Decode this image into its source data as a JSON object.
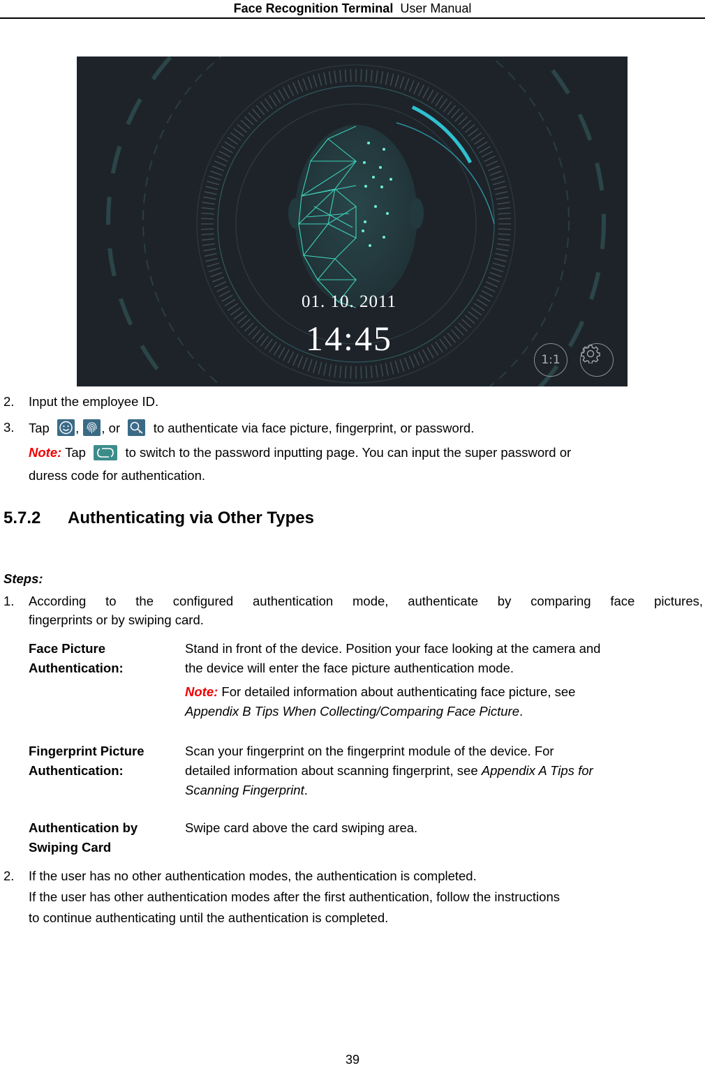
{
  "header": {
    "product": "Face Recognition Terminal",
    "doc_type": "User Manual"
  },
  "screenshot": {
    "date": "01. 10. 2011",
    "time": "14:45",
    "ratio_button": "1:1",
    "settings_icon": "gear-icon",
    "progress_fraction": 0.1,
    "colors": {
      "background": "#1e232a",
      "accent": "#2fc1d0",
      "mesh": "#3fd0bb"
    }
  },
  "steps_before": [
    {
      "number": "2.",
      "text": "Input the employee ID."
    },
    {
      "number": "3.",
      "prefix": "Tap",
      "icons": [
        "face-icon",
        "fingerprint-icon",
        "password-key-icon"
      ],
      "sep1": ",",
      "sep2": ", or",
      "suffix": "to authenticate via face picture, fingerprint, or password."
    }
  ],
  "note1": {
    "label": "Note:",
    "prefix": "Tap",
    "icon": "switch-icon",
    "line1": "to switch to the password inputting page. You can input the super password or",
    "line2": "duress code for authentication."
  },
  "section": {
    "number": "5.7.2",
    "title": "Authenticating via Other Types"
  },
  "steps_label": "Steps:",
  "step1": {
    "number": "1.",
    "line1": "According to the configured authentication mode, authenticate by comparing face pictures,",
    "line2": "fingerprints or by swiping card."
  },
  "auth_table": [
    {
      "term_line1": "Face Picture",
      "term_line2": "Authentication:",
      "desc_line1": "Stand in front of the device. Position your face looking at the camera and",
      "desc_line2": "the device will enter the face picture authentication mode.",
      "note_label": "Note:",
      "note_text": "For detailed information about authenticating face picture, see",
      "note_ref": "Appendix B Tips When Collecting/Comparing Face Picture",
      "note_end": "."
    },
    {
      "term_line1": "Fingerprint Picture",
      "term_line2": "Authentication:",
      "desc_line1": "Scan your fingerprint on the fingerprint module of the device. For",
      "desc_line2_text": "detailed information about scanning fingerprint, see",
      "desc_line2_ref": "Appendix A Tips for",
      "desc_line3_ref": "Scanning Fingerprint",
      "desc_line3_end": "."
    },
    {
      "term_line1": "Authentication by",
      "term_line2": "Swiping Card",
      "desc_line1": "Swipe card above the card swiping area."
    }
  ],
  "step2": {
    "number": "2.",
    "line1": "If the user has no other authentication modes, the authentication is completed.",
    "line2": "If the user has other authentication modes after the first authentication, follow the instructions",
    "line3": "to continue authenticating until the authentication is completed."
  },
  "page_number": "39"
}
